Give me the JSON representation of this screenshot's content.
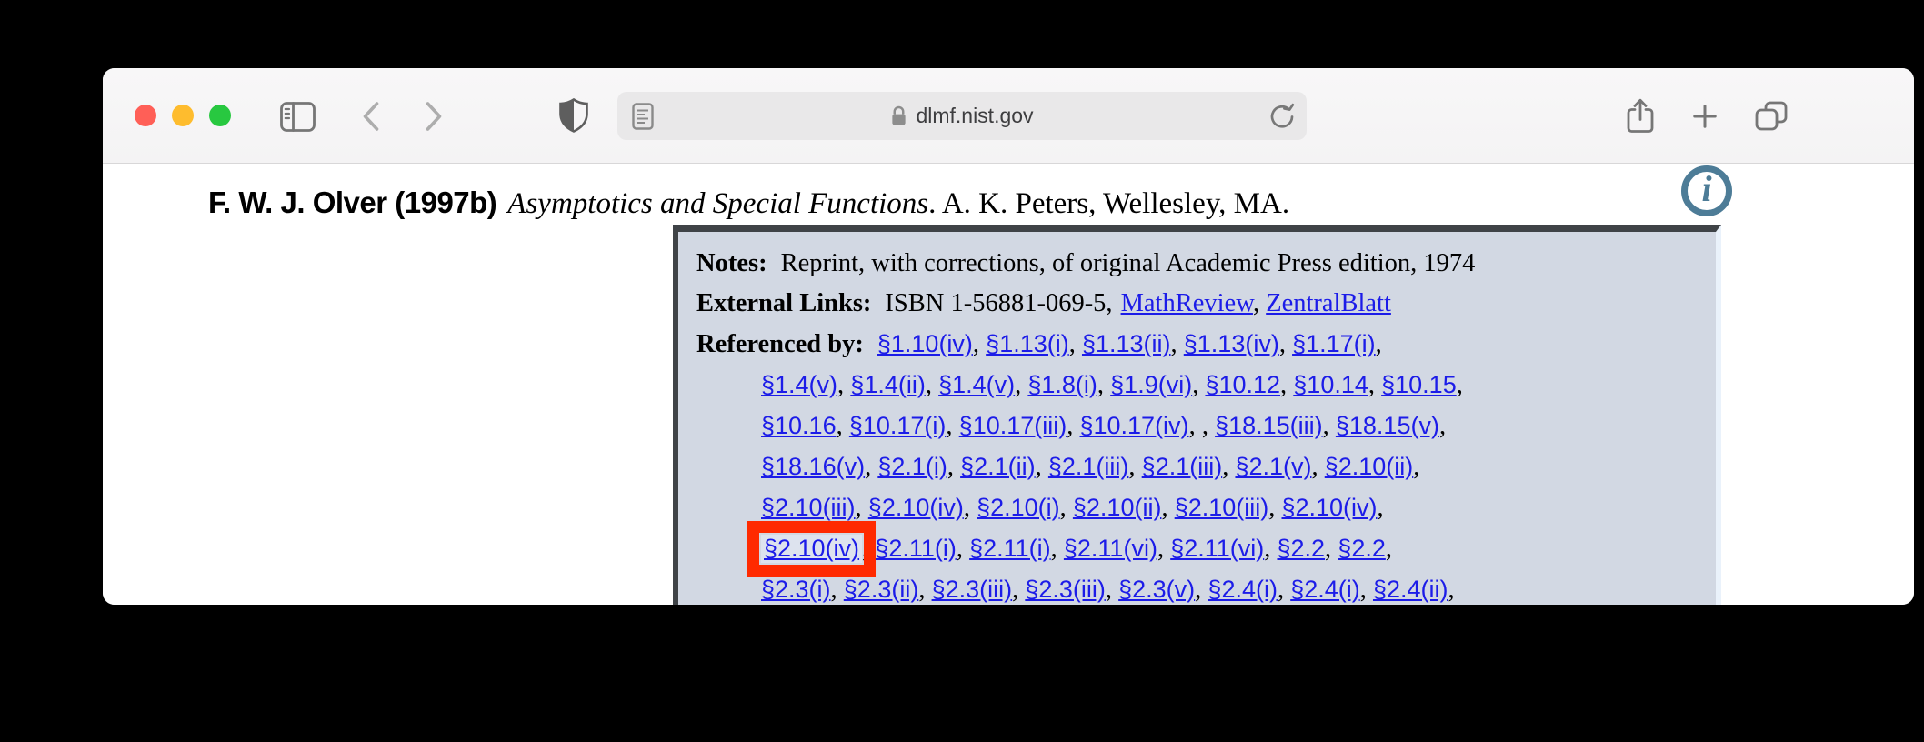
{
  "browser": {
    "url_text": "dlmf.nist.gov",
    "icons": [
      "close",
      "minimize",
      "zoom",
      "sidebar-toggle",
      "back-chevron",
      "forward-chevron",
      "privacy-shield",
      "reader",
      "lock",
      "refresh",
      "share",
      "new-tab",
      "tab-overview"
    ],
    "colors": {
      "traffic_red": "#ff5f57",
      "traffic_yellow": "#febc2e",
      "traffic_green": "#28c840"
    }
  },
  "page": {
    "heading": {
      "author": "F. W. J. Olver (1997b)",
      "title": "Asymptotics and Special Functions",
      "tail": ". A. K. Peters, Wellesley, MA."
    },
    "info_glyph": "i",
    "popup": {
      "notes_label": "Notes:",
      "notes_text": "Reprint, with corrections, of original Academic Press edition, 1974",
      "external_label": "External Links:",
      "external_prefix": "ISBN 1-56881-069-5,",
      "external_links": [
        "MathReview",
        "ZentralBlatt"
      ],
      "referenced_label": "Referenced by:",
      "ref_lines": [
        [
          "§1.10(iv)",
          "§1.13(i)",
          "§1.13(ii)",
          "§1.13(iv)",
          "§1.17(i)"
        ],
        [
          "§1.4(v)",
          "§1.4(ii)",
          "§1.4(v)",
          "§1.8(i)",
          "§1.9(vi)",
          "§10.12",
          "§10.14",
          "§10.15"
        ],
        [
          "§10.16",
          "§10.17(i)",
          "§10.17(iii)",
          "§10.17(iv)",
          "",
          "§18.15(iii)",
          "§18.15(v)"
        ],
        [
          "§18.16(v)",
          "§2.1(i)",
          "§2.1(ii)",
          "§2.1(iii)",
          "§2.1(iii)",
          "§2.1(v)",
          "§2.10(ii)"
        ],
        [
          "§2.10(iii)",
          "§2.10(iv)",
          "§2.10(i)",
          "§2.10(ii)",
          "§2.10(iii)",
          "§2.10(iv)"
        ],
        [
          "§2.10(iv)",
          "§2.11(i)",
          "§2.11(i)",
          "§2.11(vi)",
          "§2.11(vi)",
          "§2.2",
          "§2.2"
        ],
        [
          "§2.3(i)",
          "§2.3(ii)",
          "§2.3(iii)",
          "§2.3(iii)",
          "§2.3(v)",
          "§2.4(i)",
          "§2.4(i)",
          "§2.4(ii)"
        ]
      ],
      "highlight": {
        "line": 5,
        "index": 0
      },
      "colors": {
        "background": "#d2d8e3",
        "border_dark": "#3f4347",
        "border_light": "#eaf2fb",
        "link_blue": "#1c1ce8",
        "highlight_red": "#ff2a00",
        "highlight_inner": "#dde3ee"
      }
    }
  }
}
